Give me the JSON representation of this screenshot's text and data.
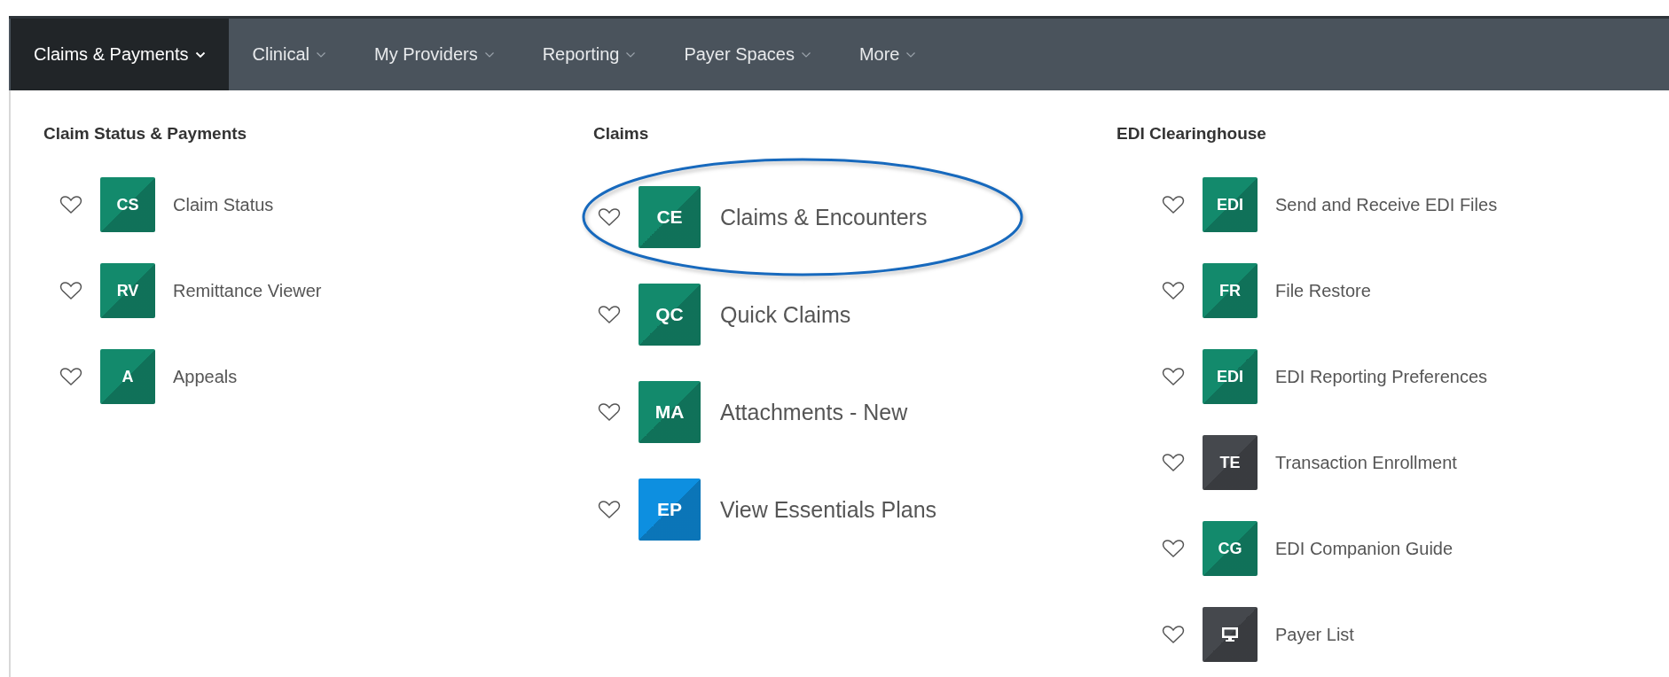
{
  "nav": [
    {
      "label": "Claims & Payments",
      "selected": true
    },
    {
      "label": "Clinical",
      "selected": false
    },
    {
      "label": "My Providers",
      "selected": false
    },
    {
      "label": "Reporting",
      "selected": false
    },
    {
      "label": "Payer Spaces",
      "selected": false
    },
    {
      "label": "More",
      "selected": false
    }
  ],
  "columns": [
    {
      "heading": "Claim Status & Payments",
      "items": [
        {
          "label": "Claim Status",
          "tile": {
            "kind": "text",
            "text": "CS",
            "color": "#138a6c"
          },
          "highlighted": false
        },
        {
          "label": "Remittance Viewer",
          "tile": {
            "kind": "text",
            "text": "RV",
            "color": "#138a6c"
          },
          "highlighted": false
        },
        {
          "label": "Appeals",
          "tile": {
            "kind": "text",
            "text": "A",
            "color": "#138a6c"
          },
          "highlighted": false
        }
      ]
    },
    {
      "heading": "Claims",
      "items": [
        {
          "label": "Claims & Encounters",
          "tile": {
            "kind": "text",
            "text": "CE",
            "color": "#138a6c"
          },
          "highlighted": true
        },
        {
          "label": "Quick Claims",
          "tile": {
            "kind": "text",
            "text": "QC",
            "color": "#138a6c"
          },
          "highlighted": false
        },
        {
          "label": "Attachments - New",
          "tile": {
            "kind": "text",
            "text": "MA",
            "color": "#138a6c"
          },
          "highlighted": false
        },
        {
          "label": "View Essentials Plans",
          "tile": {
            "kind": "text",
            "text": "EP",
            "color": "#0d8fe0"
          },
          "highlighted": false
        }
      ]
    },
    {
      "heading": "EDI Clearinghouse",
      "items": [
        {
          "label": "Send and Receive EDI Files",
          "tile": {
            "kind": "text",
            "text": "EDI",
            "color": "#138a6c"
          },
          "highlighted": false
        },
        {
          "label": "File Restore",
          "tile": {
            "kind": "text",
            "text": "FR",
            "color": "#138a6c"
          },
          "highlighted": false
        },
        {
          "label": "EDI Reporting Preferences",
          "tile": {
            "kind": "text",
            "text": "EDI",
            "color": "#138a6c"
          },
          "highlighted": false
        },
        {
          "label": "Transaction Enrollment",
          "tile": {
            "kind": "text",
            "text": "TE",
            "color": "#45484d"
          },
          "highlighted": false
        },
        {
          "label": "EDI Companion Guide",
          "tile": {
            "kind": "text",
            "text": "CG",
            "color": "#138a6c"
          },
          "highlighted": false
        },
        {
          "label": "Payer List",
          "tile": {
            "kind": "icon",
            "color": "#45484d"
          },
          "highlighted": false
        }
      ]
    }
  ]
}
